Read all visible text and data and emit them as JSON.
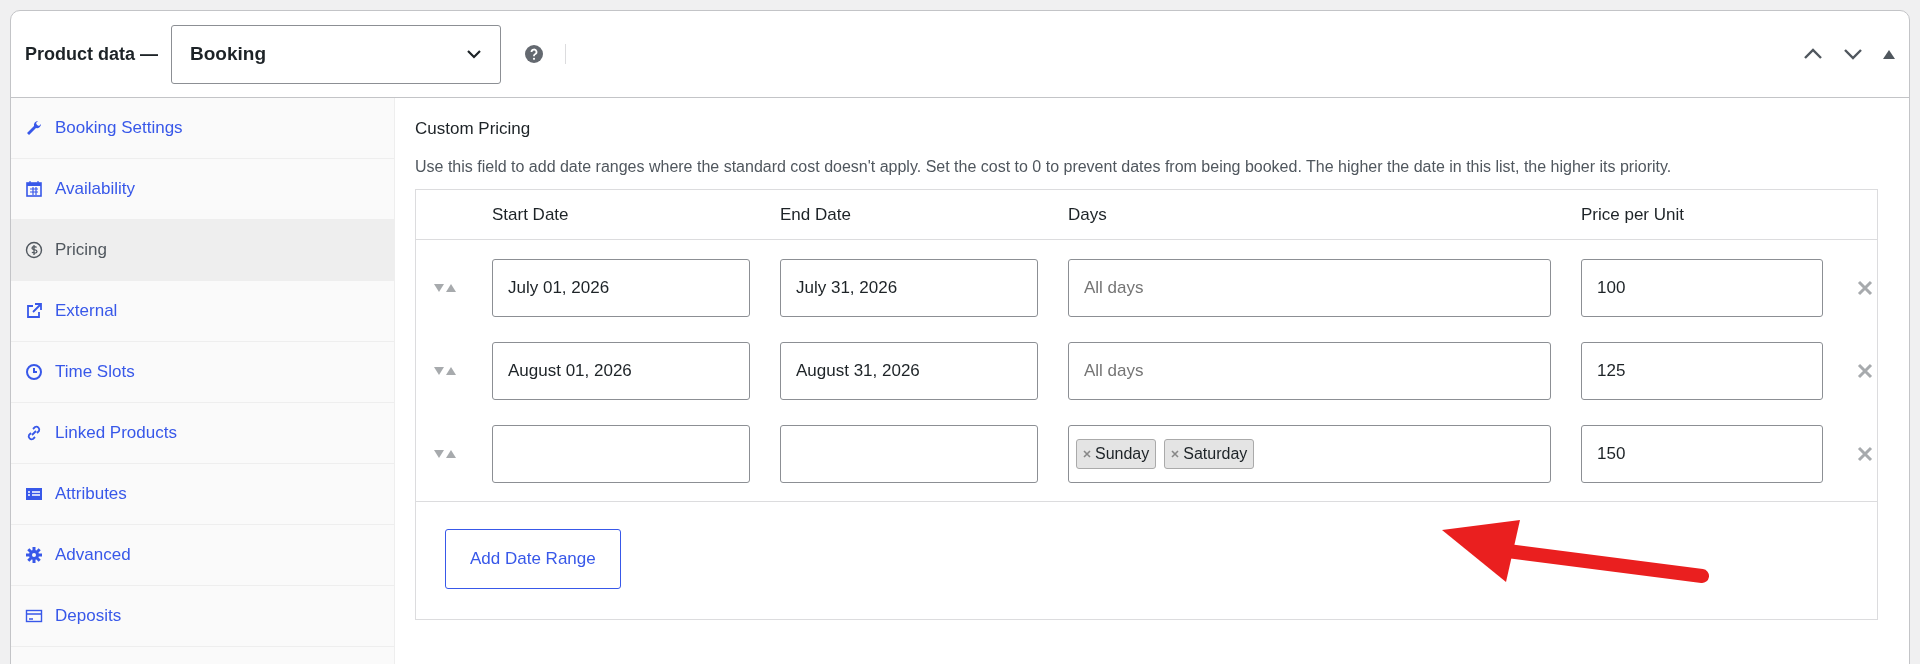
{
  "header": {
    "title": "Product data —",
    "product_type": "Booking"
  },
  "sidebar": {
    "items": [
      {
        "label": "Booking Settings",
        "selected": false
      },
      {
        "label": "Availability",
        "selected": false
      },
      {
        "label": "Pricing",
        "selected": true
      },
      {
        "label": "External",
        "selected": false
      },
      {
        "label": "Time Slots",
        "selected": false
      },
      {
        "label": "Linked Products",
        "selected": false
      },
      {
        "label": "Attributes",
        "selected": false
      },
      {
        "label": "Advanced",
        "selected": false
      },
      {
        "label": "Deposits",
        "selected": false
      }
    ]
  },
  "section": {
    "title": "Custom Pricing",
    "description": "Use this field to add date ranges where the standard cost doesn't apply. Set the cost to 0 to prevent dates from being booked. The higher the date in this list, the higher its priority."
  },
  "table": {
    "columns": [
      "Start Date",
      "End Date",
      "Days",
      "Price per Unit"
    ],
    "rows": [
      {
        "start_date": "July 01, 2026",
        "end_date": "July 31, 2026",
        "days": {
          "placeholder": "All days"
        },
        "price": "100"
      },
      {
        "start_date": "August 01, 2026",
        "end_date": "August 31, 2026",
        "days": {
          "placeholder": "All days"
        },
        "price": "125"
      },
      {
        "days": {
          "tags": [
            "Sunday",
            "Saturday"
          ]
        },
        "price": "150"
      }
    ]
  },
  "add_button": "Add Date Range"
}
